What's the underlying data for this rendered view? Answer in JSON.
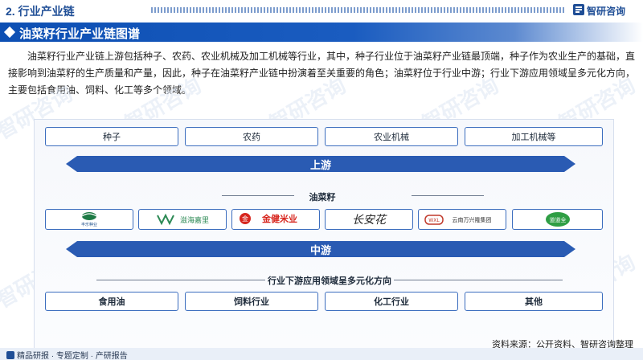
{
  "header": {
    "section": "2. 行业产业链",
    "logo_text": "智研咨询"
  },
  "title": "油菜籽行业产业链图谱",
  "intro": "油菜籽行业产业链上游包括种子、农药、农业机械及加工机械等行业，其中，种子行业位于油菜籽产业链最顶端，种子作为农业生产的基础，直接影响到油菜籽的生产质量和产量，因此，种子在油菜籽产业链中扮演着至关重要的角色；油菜籽位于行业中游；行业下游应用领域呈多元化方向，主要包括食用油、饲料、化工等多个领域。",
  "watermark": "智研咨询",
  "diagram": {
    "upstream_items": [
      "种子",
      "农药",
      "农业机械",
      "加工机械等"
    ],
    "upstream_label": "上游",
    "midstream_title": "油菜籽",
    "company_logos": [
      {
        "name": "丰乐种业",
        "icon": "fengle-logo"
      },
      {
        "name": "滋海嘉里",
        "icon": "yihai-kerry-logo"
      },
      {
        "name": "金健米业",
        "icon": "jinjian-logo"
      },
      {
        "name": "长安花",
        "icon": "changanhua-logo"
      },
      {
        "name": "云南万兴隆集团",
        "icon": "wanxinglong-logo"
      },
      {
        "name": "道道全",
        "icon": "daodaoquan-logo"
      }
    ],
    "midstream_label": "中游",
    "downstream_title": "行业下游应用领域呈多元化方向",
    "downstream_items": [
      "食用油",
      "饲料行业",
      "化工行业",
      "其他"
    ]
  },
  "footer": {
    "left": "精品研报 · 专题定制 · 产研报告",
    "source": "资料来源：公开资料、智研咨询整理"
  },
  "colors": {
    "brand_blue": "#1f4e96",
    "band_blue": "#2a5bb3",
    "title_blue": "#0d4fb3",
    "box_border": "#3b6dbe"
  }
}
